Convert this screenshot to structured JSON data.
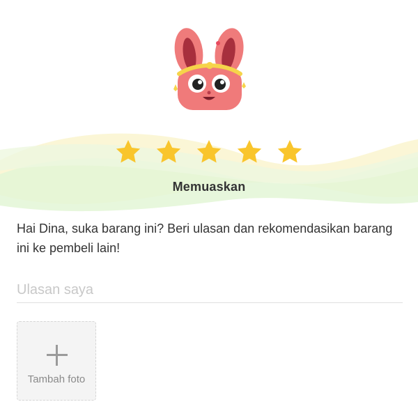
{
  "rating": {
    "value": 5,
    "max": 5,
    "label": "Memuaskan",
    "star_color": "#f9c52c"
  },
  "mascot": {
    "icon": "bunny-mascot-icon"
  },
  "prompt_text": "Hai Dina, suka barang ini? Beri ulasan dan rekomendasikan barang ini ke pembeli lain!",
  "review": {
    "value": "",
    "placeholder": "Ulasan saya"
  },
  "photo": {
    "label": "Tambah foto",
    "icon": "plus-icon"
  },
  "colors": {
    "text": "#333333",
    "placeholder": "#c8c8c8",
    "wave_green": "#e4f7d8",
    "wave_yellow": "#fbf3c8"
  }
}
